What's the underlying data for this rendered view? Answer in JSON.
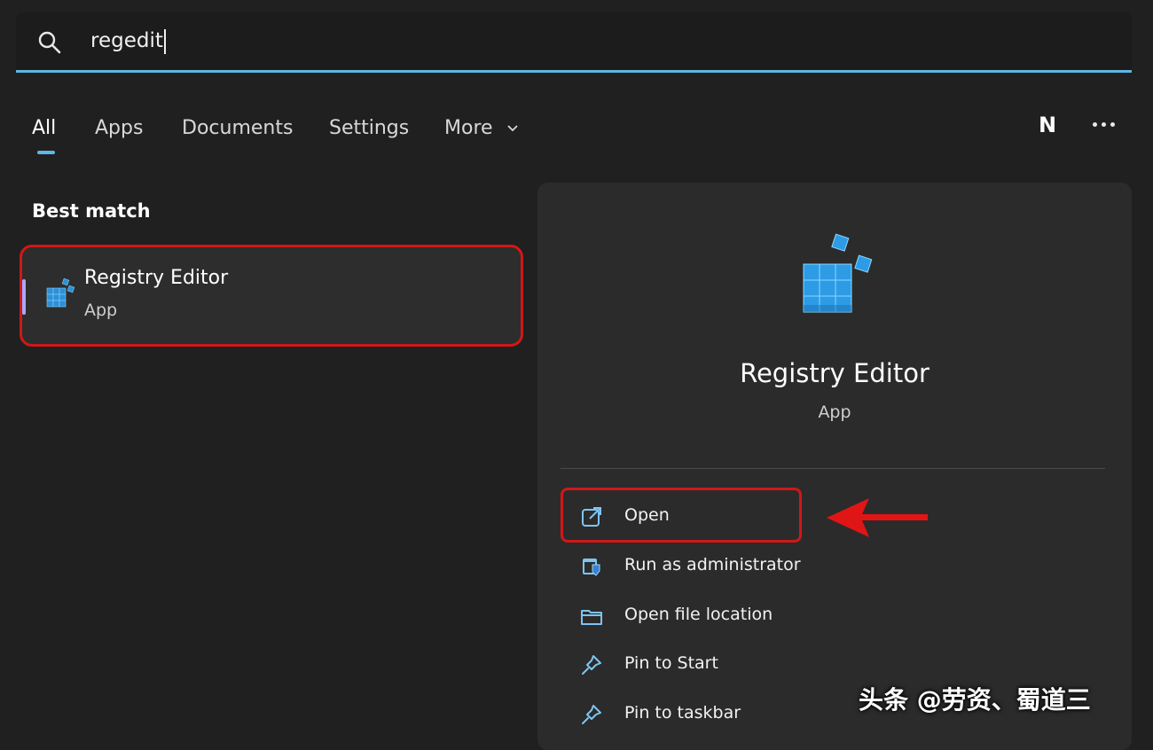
{
  "search": {
    "query": "regedit"
  },
  "tabs": [
    {
      "label": "All",
      "active": true
    },
    {
      "label": "Apps"
    },
    {
      "label": "Documents"
    },
    {
      "label": "Settings"
    },
    {
      "label": "More"
    }
  ],
  "header": {
    "avatar_letter": "N"
  },
  "best_match": {
    "heading": "Best match",
    "item": {
      "title": "Registry Editor",
      "subtitle": "App"
    }
  },
  "detail": {
    "title": "Registry Editor",
    "subtitle": "App",
    "actions": [
      {
        "label": "Open",
        "icon": "open-icon"
      },
      {
        "label": "Run as administrator",
        "icon": "shield-admin-icon"
      },
      {
        "label": "Open file location",
        "icon": "folder-icon"
      },
      {
        "label": "Pin to Start",
        "icon": "pin-icon"
      },
      {
        "label": "Pin to taskbar",
        "icon": "pin-icon"
      }
    ]
  },
  "watermark": "头条 @劳资、蜀道三",
  "colors": {
    "accent": "#5db8e6",
    "highlight": "#d11717",
    "background": "#202020",
    "panel": "#2b2b2b"
  }
}
